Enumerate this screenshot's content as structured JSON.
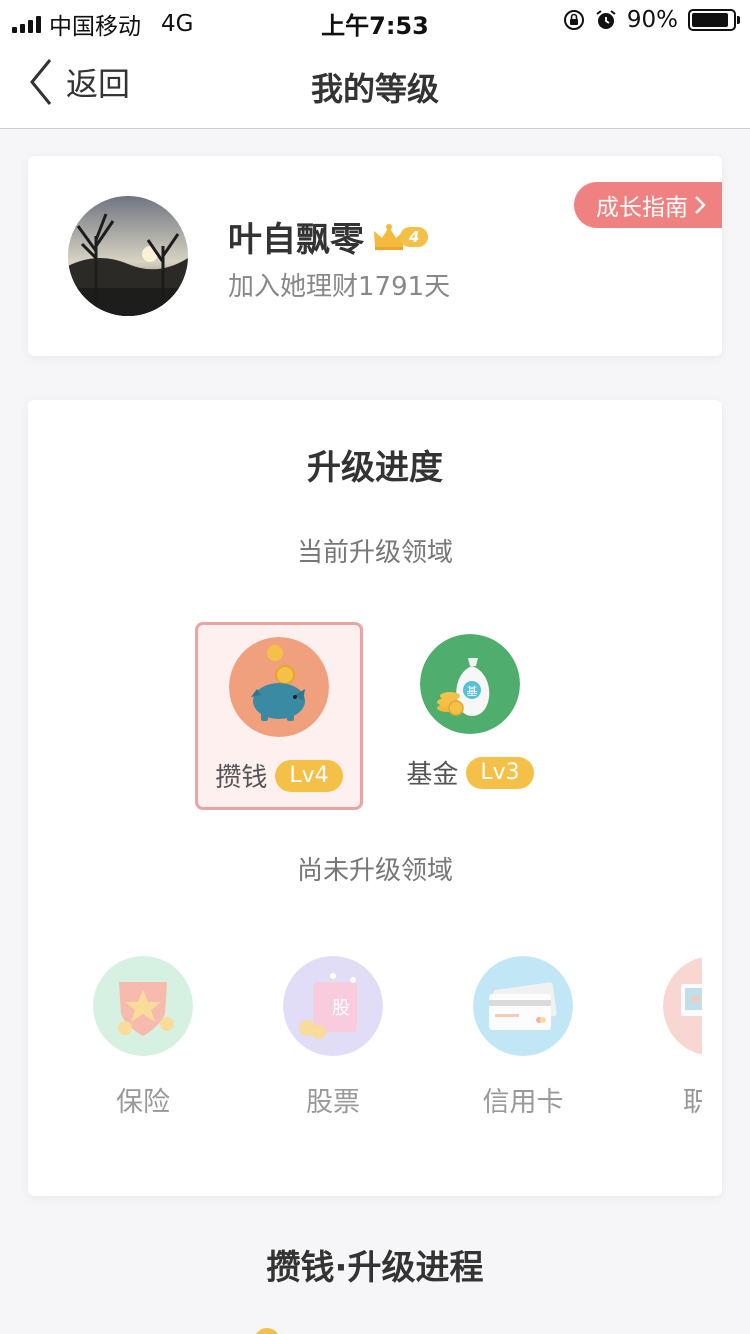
{
  "status_bar": {
    "carrier": "中国移动",
    "network": "4G",
    "time": "上午7:53",
    "battery": "90%",
    "battery_level": 0.9
  },
  "nav": {
    "back_label": "返回",
    "title": "我的等级"
  },
  "profile": {
    "name": "叶自飘零",
    "level_badge": "4",
    "join_text": "加入她理财1791天",
    "guide_label": "成长指南"
  },
  "progress": {
    "title": "升级进度",
    "current_label": "当前升级领域",
    "current_domains": [
      {
        "name": "攒钱",
        "level": "Lv4",
        "icon": "piggy-bank-icon",
        "color": "#f0a07d"
      },
      {
        "name": "基金",
        "level": "Lv3",
        "icon": "fund-bag-icon",
        "color": "#4fae6e"
      }
    ],
    "pending_label": "尚未升级领域",
    "pending_domains": [
      {
        "name": "保险",
        "icon": "insurance-shield-icon"
      },
      {
        "name": "股票",
        "icon": "stock-icon"
      },
      {
        "name": "信用卡",
        "icon": "credit-card-icon"
      },
      {
        "name": "职",
        "icon": "career-icon"
      }
    ]
  },
  "section2": {
    "title": "攒钱·升级进程"
  },
  "colors": {
    "accent_pink": "#ef8280",
    "level_gold": "#f5c048",
    "fund_green": "#4fae6e",
    "piggy_orange": "#f0a07d"
  }
}
